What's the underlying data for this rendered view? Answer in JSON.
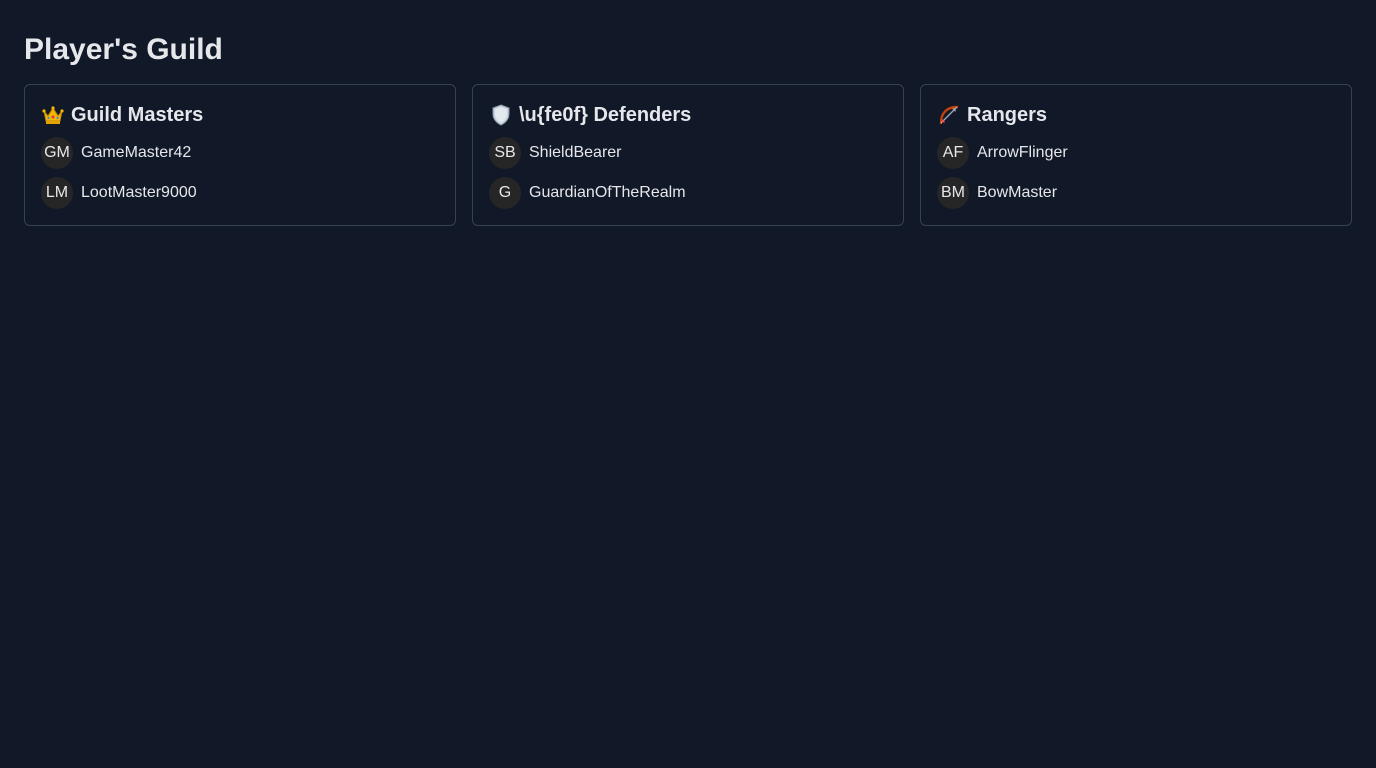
{
  "page": {
    "title": "Player's Guild"
  },
  "groups": [
    {
      "icon": "crown-icon",
      "title": "Guild Masters",
      "members": [
        {
          "initials": "GM",
          "name": "GameMaster42"
        },
        {
          "initials": "LM",
          "name": "LootMaster9000"
        }
      ]
    },
    {
      "icon": "shield-icon",
      "title": "\\u{fe0f} Defenders",
      "members": [
        {
          "initials": "SB",
          "name": "ShieldBearer"
        },
        {
          "initials": "G",
          "name": "GuardianOfTheRealm"
        }
      ]
    },
    {
      "icon": "bow-and-arrow-icon",
      "title": "Rangers",
      "members": [
        {
          "initials": "AF",
          "name": "ArrowFlinger"
        },
        {
          "initials": "BM",
          "name": "BowMaster"
        }
      ]
    }
  ],
  "colors": {
    "background": "#111827",
    "text": "#e5e7eb",
    "card_border": "#374151",
    "avatar_bg": "#262626",
    "crown": "#f5b800",
    "shield": "#c9d3dd",
    "bow": "#c2410c"
  }
}
